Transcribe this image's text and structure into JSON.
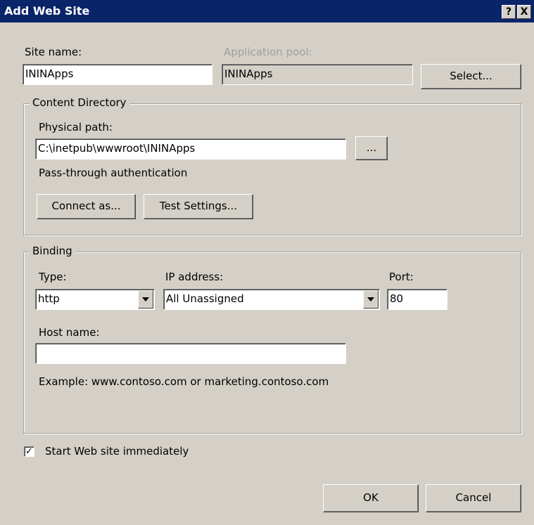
{
  "window": {
    "title": "Add Web Site",
    "help_glyph": "?",
    "close_glyph": "X"
  },
  "site": {
    "site_name_label": "Site name:",
    "site_name_value": "ININApps",
    "app_pool_label": "Application pool:",
    "app_pool_value": "ININApps",
    "select_button": "Select..."
  },
  "content_directory": {
    "legend": "Content Directory",
    "physical_path_label": "Physical path:",
    "physical_path_value": "C:\\inetpub\\wwwroot\\ININApps",
    "browse_button": "...",
    "auth_text": "Pass-through authentication",
    "connect_as_button": "Connect as...",
    "test_settings_button": "Test Settings..."
  },
  "binding": {
    "legend": "Binding",
    "type_label": "Type:",
    "type_value": "http",
    "ip_label": "IP address:",
    "ip_value": "All Unassigned",
    "port_label": "Port:",
    "port_value": "80",
    "host_label": "Host name:",
    "host_value": "",
    "example_text": "Example: www.contoso.com or marketing.contoso.com"
  },
  "start_immediately": {
    "label": "Start Web site immediately",
    "checked": true,
    "check_glyph": "✓"
  },
  "footer": {
    "ok_button": "OK",
    "cancel_button": "Cancel"
  }
}
